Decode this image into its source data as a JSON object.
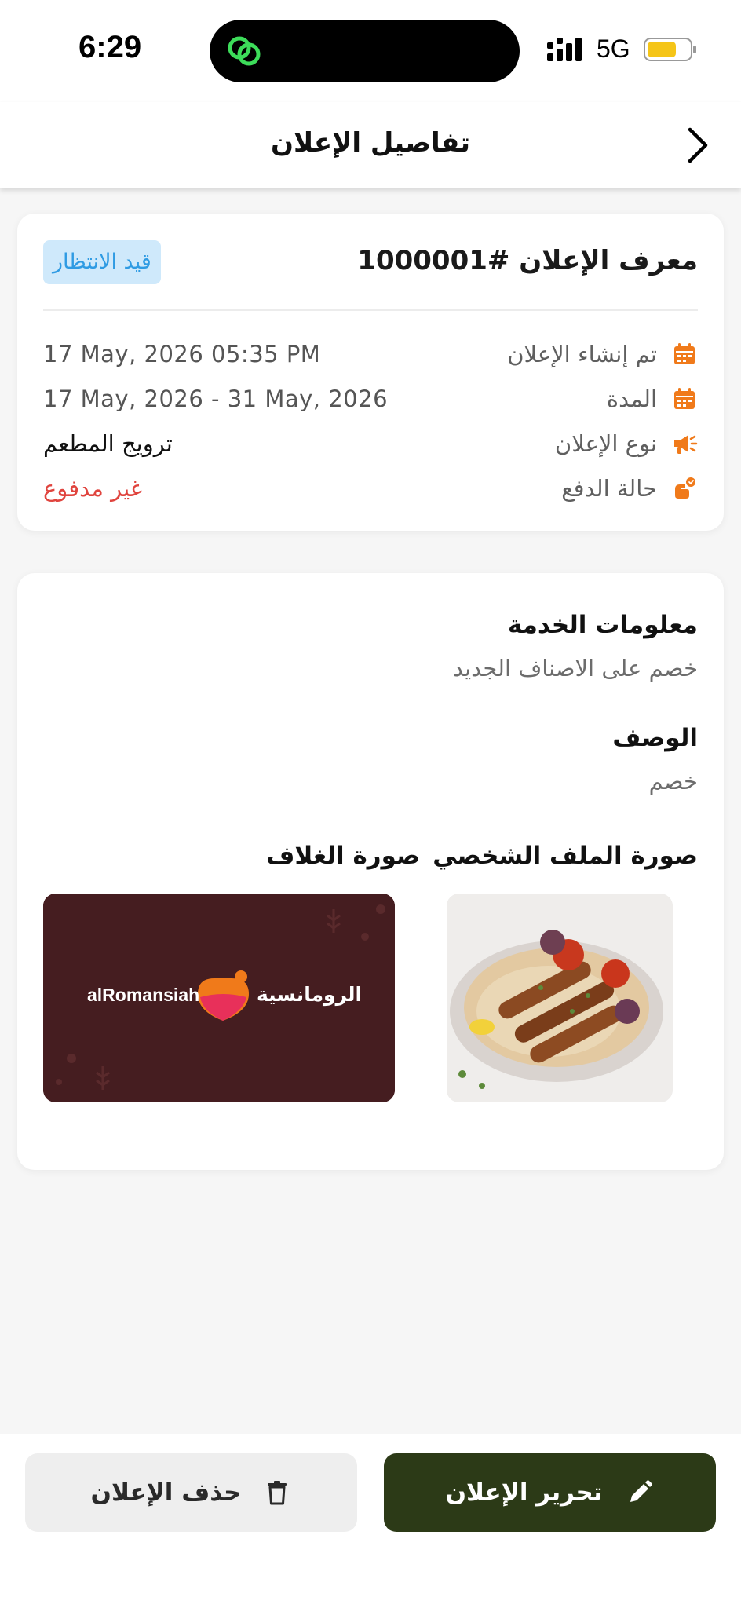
{
  "status_bar": {
    "time": "6:29",
    "network": "5G"
  },
  "header": {
    "title": "تفاصيل الإعلان"
  },
  "ad_card": {
    "id_label": "معرف الإعلان #1000001",
    "status_badge": "قيد الانتظار",
    "rows": [
      {
        "label": "تم إنشاء الإعلان",
        "value": "17 May, 2026 05:35 PM",
        "icon": "calendar-icon"
      },
      {
        "label": "المدة",
        "value": "17 May, 2026 - 31 May, 2026",
        "icon": "calendar-icon"
      },
      {
        "label": "نوع الإعلان",
        "value": "ترويج المطعم",
        "icon": "megaphone-icon"
      },
      {
        "label": "حالة الدفع",
        "value": "غير مدفوع",
        "icon": "payment-icon"
      }
    ]
  },
  "details_card": {
    "service_title": "معلومات الخدمة",
    "service_text": "خصم على الاصناف الجديد",
    "description_title": "الوصف",
    "description_text": "خصم",
    "profile_image_title": "صورة الملف الشخصي",
    "cover_image_title": "صورة الغلاف",
    "cover_brand_latin": "alRomansiah",
    "cover_brand_arabic": "الرومانسية"
  },
  "actions": {
    "edit_label": "تحرير الإعلان",
    "delete_label": "حذف الإعلان"
  },
  "colors": {
    "accent_orange": "#f07a1a",
    "primary_button": "#2c3a17",
    "badge_bg": "#cfe9fb",
    "badge_text": "#2f9be3",
    "unpaid_red": "#e0443e",
    "cover_bg": "#451d20"
  }
}
